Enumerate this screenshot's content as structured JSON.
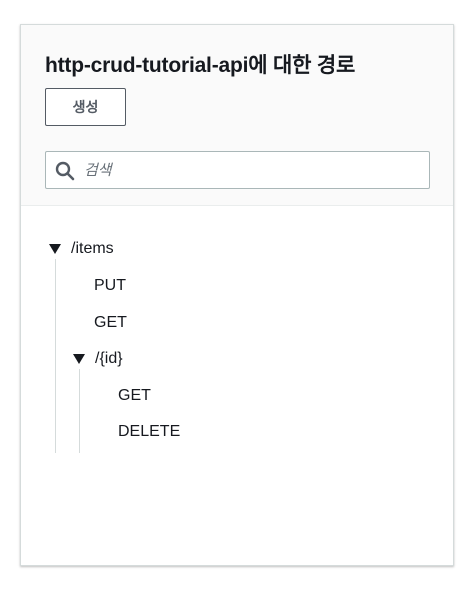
{
  "panel": {
    "title": "http-crud-tutorial-api에 대한 경로",
    "create_button_label": "생성",
    "search": {
      "placeholder": "검색",
      "value": ""
    }
  },
  "tree": {
    "root": {
      "path": "/items",
      "expanded": true,
      "methods": [
        "PUT",
        "GET"
      ],
      "child": {
        "path": "/{id}",
        "expanded": true,
        "methods": [
          "GET",
          "DELETE"
        ]
      }
    }
  },
  "colors": {
    "header_bg": "#fafafa",
    "border": "#d5dbdb",
    "button_text": "#545b64",
    "text": "#16191f"
  }
}
